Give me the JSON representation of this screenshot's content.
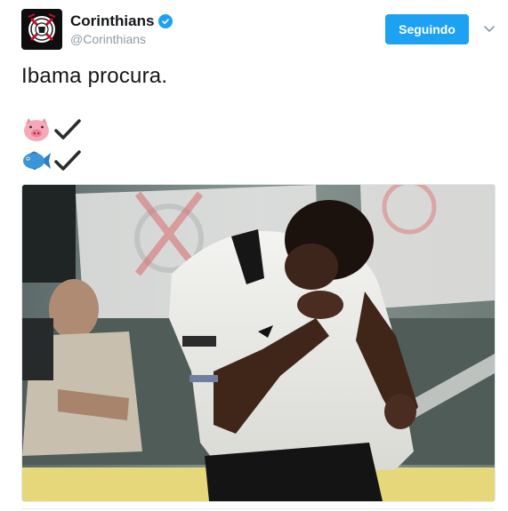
{
  "account": {
    "display_name": "Corinthians",
    "handle": "@Corinthians",
    "verified": true,
    "avatar_icon": "corinthians-crest-icon"
  },
  "follow_button": {
    "label": "Seguindo"
  },
  "tweet": {
    "text": "Ibama procura.",
    "emoji_lines": [
      {
        "emoji_icon": "pig-face-icon",
        "mark_icon": "check-mark-icon"
      },
      {
        "emoji_icon": "fish-icon",
        "mark_icon": "check-mark-icon"
      }
    ],
    "media": {
      "description_icon": "player-photo-icon"
    }
  },
  "colors": {
    "accent": "#1da1f2",
    "text": "#14171a",
    "muted": "#8f9ba5",
    "pig": "#f4a9b8",
    "fish": "#3b95d8",
    "pitch_yellow": "#e6d77a"
  }
}
